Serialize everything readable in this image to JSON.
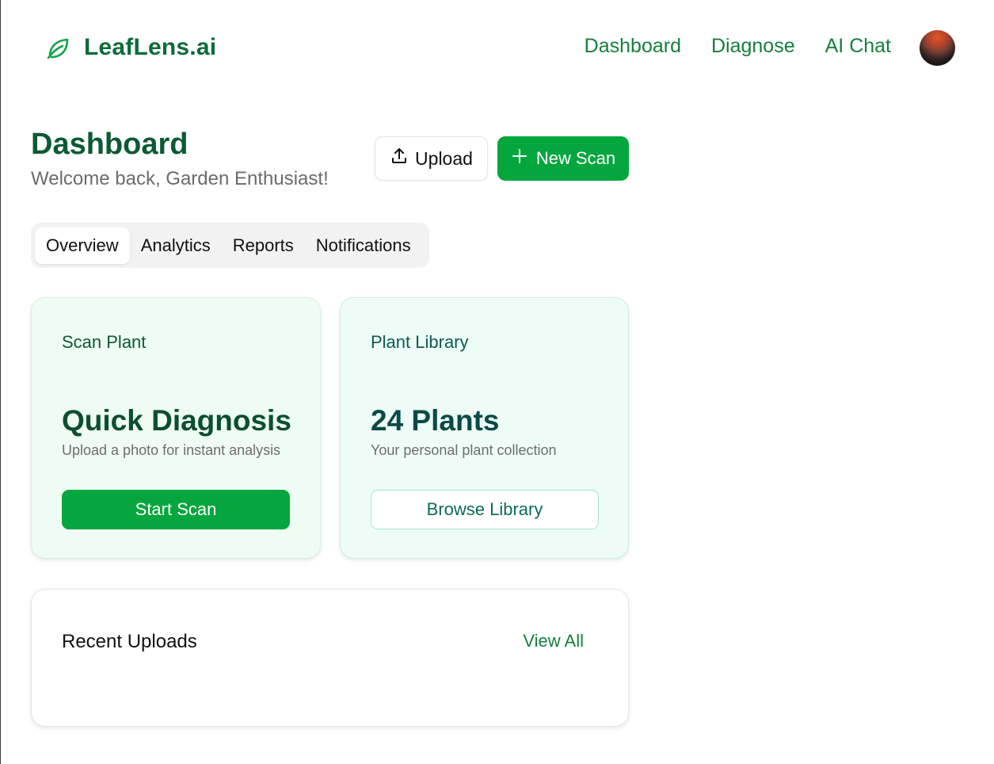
{
  "brand": {
    "name": "LeafLens.ai",
    "icon": "leaf-icon",
    "color": "#0b6b3a"
  },
  "nav": {
    "items": [
      "Dashboard",
      "Diagnose",
      "AI Chat"
    ]
  },
  "header": {
    "title": "Dashboard",
    "subtitle": "Welcome back, Garden Enthusiast!"
  },
  "actions": {
    "upload_label": "Upload",
    "upload_icon": "upload-icon",
    "new_scan_label": "New Scan",
    "new_scan_icon": "plus-icon"
  },
  "tabs": [
    {
      "label": "Overview",
      "active": true
    },
    {
      "label": "Analytics",
      "active": false
    },
    {
      "label": "Reports",
      "active": false
    },
    {
      "label": "Notifications",
      "active": false
    }
  ],
  "cards": {
    "scan": {
      "label": "Scan Plant",
      "headline": "Quick Diagnosis",
      "description": "Upload a photo for instant analysis",
      "button": "Start Scan"
    },
    "library": {
      "label": "Plant Library",
      "headline": "24 Plants",
      "description": "Your personal plant collection",
      "button": "Browse Library"
    }
  },
  "recent": {
    "title": "Recent Uploads",
    "view_all": "View All"
  },
  "colors": {
    "primary": "#06a63e",
    "dark_green": "#0b5a33",
    "link_green": "#15803d"
  }
}
